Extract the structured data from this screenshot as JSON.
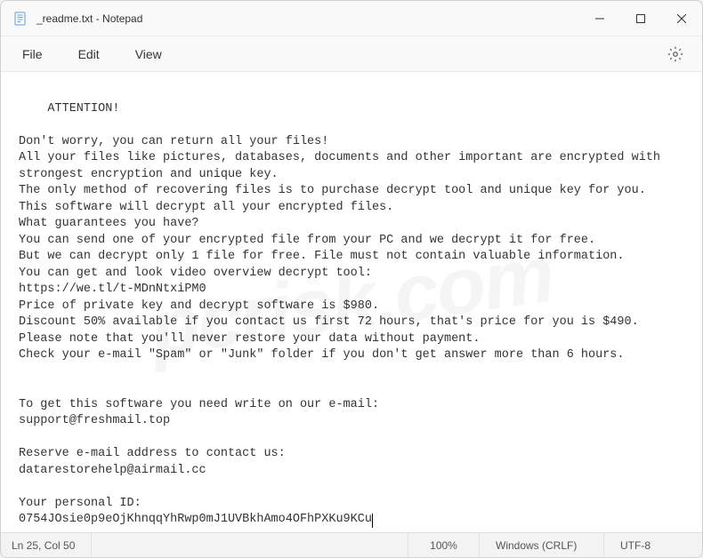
{
  "titlebar": {
    "title": "_readme.txt - Notepad"
  },
  "menubar": {
    "file": "File",
    "edit": "Edit",
    "view": "View"
  },
  "content": {
    "body": "ATTENTION!\n\nDon't worry, you can return all your files!\nAll your files like pictures, databases, documents and other important are encrypted with strongest encryption and unique key.\nThe only method of recovering files is to purchase decrypt tool and unique key for you.\nThis software will decrypt all your encrypted files.\nWhat guarantees you have?\nYou can send one of your encrypted file from your PC and we decrypt it for free.\nBut we can decrypt only 1 file for free. File must not contain valuable information.\nYou can get and look video overview decrypt tool:\nhttps://we.tl/t-MDnNtxiPM0\nPrice of private key and decrypt software is $980.\nDiscount 50% available if you contact us first 72 hours, that's price for you is $490.\nPlease note that you'll never restore your data without payment.\nCheck your e-mail \"Spam\" or \"Junk\" folder if you don't get answer more than 6 hours.\n\n\nTo get this software you need write on our e-mail:\nsupport@freshmail.top\n\nReserve e-mail address to contact us:\ndatarestorehelp@airmail.cc\n\nYour personal ID:\n0754JOsie0p9eOjKhnqqYhRwp0mJ1UVBkhAmo4OFhPXKu9KCu"
  },
  "statusbar": {
    "lncol": "Ln 25, Col 50",
    "zoom": "100%",
    "eol": "Windows (CRLF)",
    "encoding": "UTF-8"
  },
  "watermark": "pcrisk.com"
}
